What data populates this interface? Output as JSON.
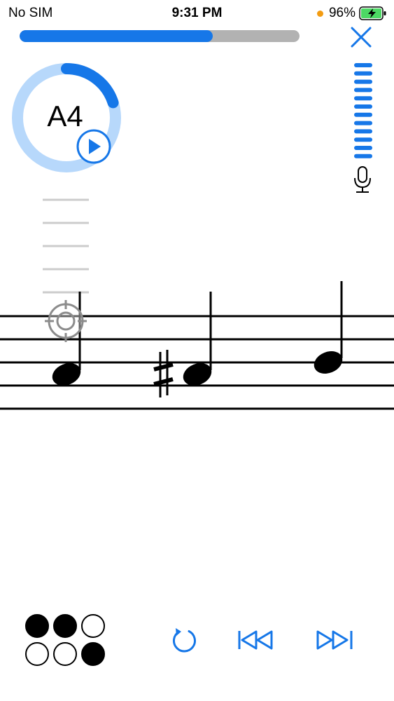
{
  "status_bar": {
    "carrier": "No SIM",
    "time": "9:31 PM",
    "battery": "96%"
  },
  "progress": {
    "fraction": 0.69
  },
  "target_note": {
    "name": "A4",
    "ring_progress_fraction": 0.2
  },
  "input_level": {
    "bars_total": 12,
    "bars_active": 12
  },
  "staff": {
    "notes": [
      {
        "position": "space-3-below-top",
        "accidental": ""
      },
      {
        "position": "space-3-below-top",
        "accidental": "sharp"
      },
      {
        "position": "line-3",
        "accidental": ""
      }
    ]
  },
  "result_dots": [
    true,
    true,
    false,
    false,
    false,
    true
  ],
  "colors": {
    "accent": "#1677e8",
    "ring_track": "#b7d8fb",
    "progress_track": "#b2b2b2"
  },
  "icons": {
    "close": "close-icon",
    "play": "play-icon",
    "mic": "microphone-icon",
    "target": "target-icon",
    "repeat": "repeat-icon",
    "previous": "skip-back-icon",
    "next": "skip-forward-icon"
  }
}
